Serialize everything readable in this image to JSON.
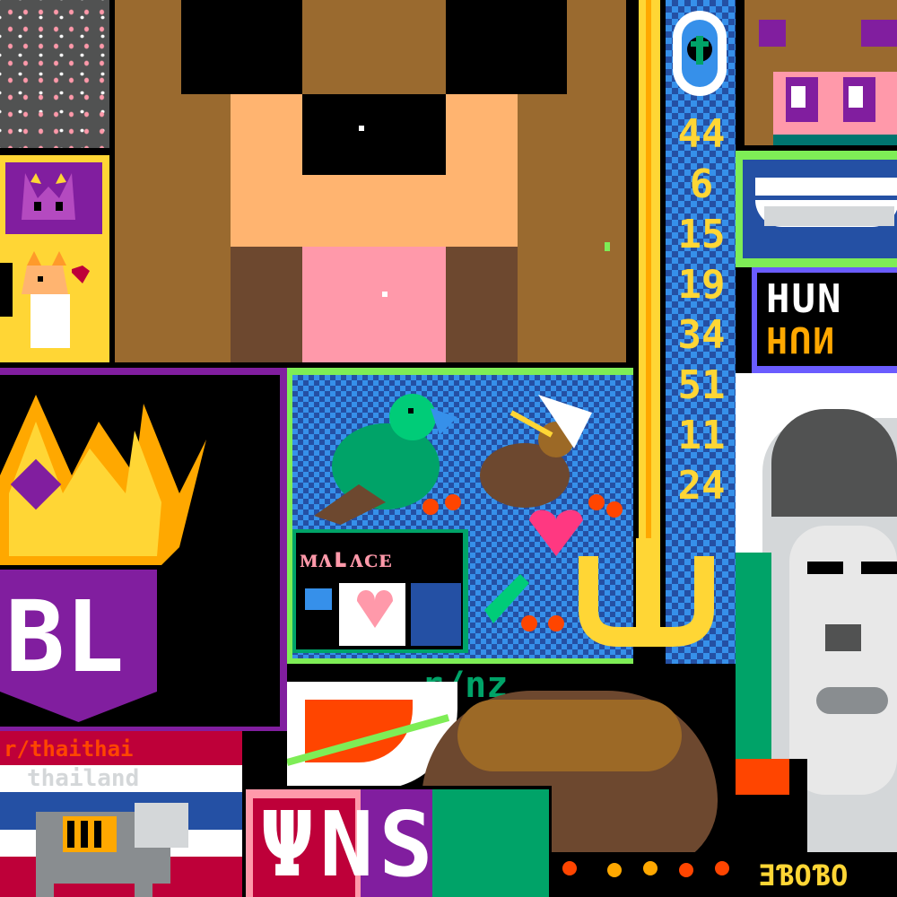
{
  "canvas": {
    "texts": {
      "bl": "BL",
      "hun_top": "HUN",
      "hun_bottom": "HUN",
      "hellmo": "ᴍᴧʟᴧᴄᴇ",
      "rnz": "r/nz",
      "thai_top": "r/thaithai",
      "thai_mid": "thailand",
      "wns": "ΨNS",
      "bottom_right": "ƎƁՕƁՕ",
      "number_column": [
        "44",
        "6",
        "15",
        "19",
        "34",
        "51",
        "11",
        "24"
      ]
    },
    "colors": {
      "minecraft_brown": "#9a6a2f",
      "minecraft_skin": "#ffb470",
      "minecraft_pink": "#ff99aa",
      "trident_gold": "#ffd635",
      "checker_blue": "#3690ea",
      "purple": "#811e9f",
      "green_border": "#7eed56",
      "hun_navy": "#2450a4"
    }
  }
}
